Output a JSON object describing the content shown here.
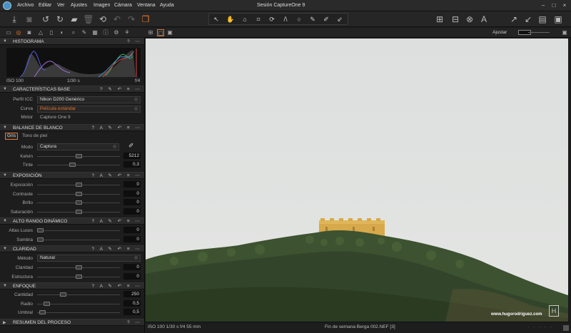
{
  "window": {
    "title": "Sesión CaptureOne 9",
    "menu": [
      "Archivo",
      "Editar",
      "Ver",
      "Ajustes",
      "Imagen",
      "Cámara",
      "Ventana",
      "Ayuda"
    ]
  },
  "viewer_controls": {
    "adjust_label": "Ajustar"
  },
  "sections": {
    "histogram": {
      "title": "HISTOGRAMA",
      "iso": "ISO 100",
      "shutter": "1/30 s",
      "aperture": "f/4"
    },
    "base": {
      "title": "CARACTERÍSTICAS BASE",
      "icc_label": "Perfil ICC",
      "icc_value": "Nikon D200 Genérico",
      "curve_label": "Curva",
      "curve_value": "Película estándar",
      "engine_label": "Motor",
      "engine_value": "Capture One 9"
    },
    "white_balance": {
      "title": "BALANCE DE BLANCO",
      "tab_gray": "Gris",
      "tab_skin": "Tono de piel",
      "mode_label": "Modo",
      "mode_value": "Captura",
      "kelvin_label": "Kelvin",
      "kelvin_value": "5212",
      "kelvin_level": 0.5,
      "tint_label": "Tinte",
      "tint_value": "0,3",
      "tint_level": 0.42
    },
    "exposure": {
      "title": "EXPOSICIÓN",
      "rows": [
        {
          "label": "Exposición",
          "value": "0"
        },
        {
          "label": "Contraste",
          "value": "0"
        },
        {
          "label": "Brillo",
          "value": "0"
        },
        {
          "label": "Saturación",
          "value": "0"
        }
      ]
    },
    "hdr": {
      "title": "ALTO RANGO DINÁMICO",
      "rows": [
        {
          "label": "Altas Luces",
          "value": "0"
        },
        {
          "label": "Sombra",
          "value": "0"
        }
      ]
    },
    "clarity": {
      "title": "CLARIDAD",
      "method_label": "Método",
      "method_value": "Natural",
      "rows": [
        {
          "label": "Claridad",
          "value": "0"
        },
        {
          "label": "Estructura",
          "value": "0"
        }
      ]
    },
    "sharpening": {
      "title": "ENFOQUE",
      "rows": [
        {
          "label": "Cantidad",
          "value": "250",
          "level": 0.3
        },
        {
          "label": "Radio",
          "value": "0,5",
          "level": 0.08
        },
        {
          "label": "Umbral",
          "value": "0,5",
          "level": 0.03
        }
      ]
    },
    "process": {
      "title": "RESUMEN DEL PROCESO"
    }
  },
  "status": {
    "left": "ISO 100  1/30 s  f/4  55 mm",
    "center": "Fin de semana Berga 002.NEF [3]"
  },
  "watermark": "www.hugorodriguez.com",
  "colors": {
    "accent_orange": "#e8742a",
    "panel": "#1d1d1d"
  }
}
